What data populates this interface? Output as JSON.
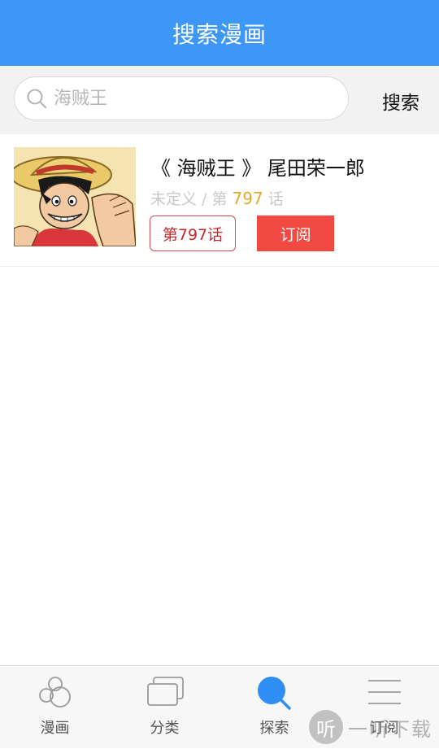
{
  "header": {
    "title": "搜索漫画"
  },
  "search": {
    "placeholder": "海贼王",
    "value": "",
    "button_label": "搜索"
  },
  "result": {
    "title": "《 海贼王 》 尾田荣一郎",
    "status": "未定义 / 第",
    "chapter_count": "797",
    "chapter_suffix": "话",
    "chapter_button": "第797话",
    "subscribe_button": "订阅"
  },
  "tabs": [
    {
      "label": "漫画",
      "icon": "manga-icon"
    },
    {
      "label": "分类",
      "icon": "category-icon"
    },
    {
      "label": "探索",
      "icon": "explore-icon",
      "active": true
    },
    {
      "label": "订阅",
      "icon": "subscribe-list-icon"
    }
  ],
  "watermark": {
    "logo": "听",
    "text": "一听下载"
  },
  "colors": {
    "header": "#3d97f6",
    "accent_red": "#f24a43",
    "count_orange": "#e3a92b",
    "active_tab": "#2f8ef3"
  }
}
